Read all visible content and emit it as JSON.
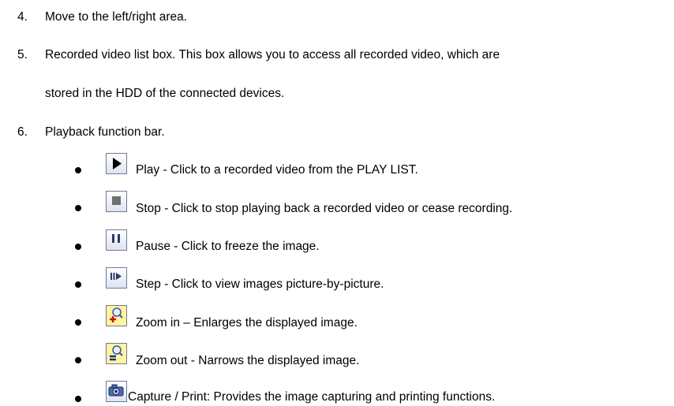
{
  "items": [
    {
      "number": "4.",
      "text": "Move to the left/right area."
    },
    {
      "number": "5.",
      "lines": [
        "Recorded video list box. This box allows you to access all recorded video, which are",
        "stored in the HDD of the connected devices."
      ]
    },
    {
      "number": "6.",
      "text": "Playback function bar."
    }
  ],
  "bullets": [
    {
      "icon": "play-icon",
      "text": "Play - Click to a recorded video from the PLAY LIST."
    },
    {
      "icon": "stop-icon",
      "text": "Stop - Click to stop playing back a recorded video or cease recording."
    },
    {
      "icon": "pause-icon",
      "text": "Pause - Click to freeze the image."
    },
    {
      "icon": "step-icon",
      "text": "Step - Click to view images picture-by-picture."
    },
    {
      "icon": "zoom-in-icon",
      "text": "Zoom in – Enlarges the displayed  image."
    },
    {
      "icon": "zoom-out-icon",
      "text": "Zoom out - Narrows the displayed  image."
    },
    {
      "icon": "capture-icon",
      "text": "Capture / Print: Provides the image capturing and printing functions."
    }
  ]
}
